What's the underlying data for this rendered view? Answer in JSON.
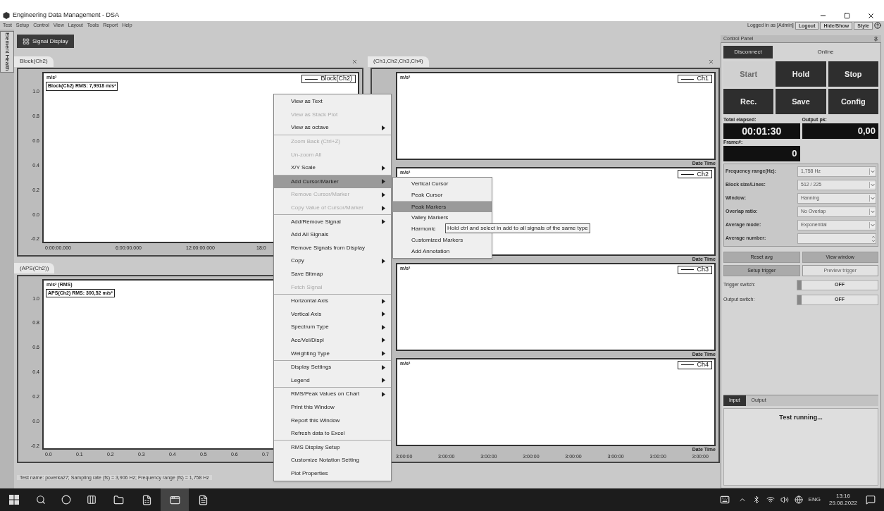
{
  "window": {
    "title": "Engineering Data Management - DSA"
  },
  "menu_bar": [
    "Test",
    "Setup",
    "Control",
    "View",
    "Layout",
    "Tools",
    "Report",
    "Help"
  ],
  "session": {
    "user": "Logged in as [Admin]",
    "buttons": [
      "Logout",
      "Hide/Show",
      "Style"
    ]
  },
  "side_strip": {
    "label": "Element Health"
  },
  "document_tab": {
    "label": "Signal Display",
    "selected": true
  },
  "left_panels": [
    {
      "tab": "Block(Ch2)",
      "y_label": "m/s²",
      "rms_label": "Block(Ch2) RMS: 7,9918 m/s²",
      "legend": "Block(Ch2)",
      "y_ticks": [
        "1.0",
        "0.8",
        "0.6",
        "0.4",
        "0.2",
        "0.0",
        "-0.2"
      ],
      "x_ticks": [
        "0:00:00.000",
        "6:00:00.000",
        "12:00:00.000",
        "18:0"
      ]
    },
    {
      "tab": "(APS(Ch2))",
      "y_label": "m/s² (RMS)",
      "rms_label": "APS(Ch2) RMS: 300,52 m/s²",
      "y_ticks": [
        "1.0",
        "0.8",
        "0.6",
        "0.4",
        "0.2",
        "0.0",
        "-0.2"
      ],
      "x_ticks": [
        "0.0",
        "0.1",
        "0.2",
        "0.3",
        "0.4",
        "0.5",
        "0.6",
        "0.7"
      ]
    }
  ],
  "channels_panel": {
    "tab": "(Ch1,Ch2,Ch3,Ch4)",
    "plots": [
      {
        "y_label": "m/s²",
        "legend": "Ch1",
        "x_caption": "Date Time"
      },
      {
        "y_label": "m/s²",
        "legend": "Ch2",
        "x_caption": "Date Time"
      },
      {
        "y_label": "m/s²",
        "legend": "Ch3",
        "x_caption": "Date Time"
      },
      {
        "y_label": "m/s²",
        "legend": "Ch4",
        "x_caption": "Date Time"
      }
    ],
    "x_ticks": [
      "3:00:00",
      "3:00:00",
      "3:00:00",
      "3:00:00",
      "3:00:00",
      "3:00:00",
      "3:00:00",
      "3:00:00"
    ]
  },
  "control_panel": {
    "title": "Control Panel",
    "connect_button": "Disconnect",
    "connection_status": "Online",
    "run_buttons": [
      {
        "label": "Start",
        "disabled": true
      },
      {
        "label": "Hold",
        "disabled": false
      },
      {
        "label": "Stop",
        "disabled": false
      },
      {
        "label": "Rec.",
        "disabled": false
      },
      {
        "label": "Save",
        "disabled": false
      },
      {
        "label": "Config",
        "disabled": false
      }
    ],
    "readouts": [
      {
        "label": "Total elapsed:",
        "value": "00:01:30"
      },
      {
        "label": "Output pk:",
        "value": "0,00"
      },
      {
        "label": "Frame#:",
        "value": "0"
      }
    ],
    "parameters": [
      {
        "label": "Frequency range(Hz):",
        "value": "1,758 Hz",
        "kind": "dropdown"
      },
      {
        "label": "Block size/Lines:",
        "value": "512 / 225",
        "kind": "dropdown"
      },
      {
        "label": "Window:",
        "value": "Hanning",
        "kind": "dropdown"
      },
      {
        "label": "Overlap ratio:",
        "value": "No Overlap",
        "kind": "dropdown"
      },
      {
        "label": "Average mode:",
        "value": "Exponential",
        "kind": "dropdown"
      },
      {
        "label": "Average number:",
        "kind": "spinner"
      }
    ],
    "action_buttons": [
      {
        "label": "Reset avg",
        "disabled": false
      },
      {
        "label": "View window",
        "disabled": false
      },
      {
        "label": "Setup trigger",
        "disabled": false
      },
      {
        "label": "Preview trigger",
        "disabled": true
      }
    ],
    "switches": [
      {
        "label": "Trigger switch:",
        "state_label": "OFF",
        "on": false
      },
      {
        "label": "Output switch:",
        "state_label": "OFF",
        "on": false
      }
    ],
    "output_tabs": [
      {
        "label": "Input",
        "selected": true
      },
      {
        "label": "Output",
        "selected": false
      }
    ],
    "message": "Test running..."
  },
  "context_menu": {
    "sections": [
      {
        "items": [
          {
            "label": "View as Text",
            "disabled": false,
            "has_submenu": false,
            "selected": false
          },
          {
            "label": "View as Stack Plot",
            "disabled": true,
            "has_submenu": false,
            "selected": false
          },
          {
            "label": "View as octave",
            "disabled": false,
            "has_submenu": true,
            "selected": false
          }
        ]
      },
      {
        "items": [
          {
            "label": "Zoom Back (Ctrl+Z)",
            "disabled": true,
            "has_submenu": false,
            "selected": false
          },
          {
            "label": "Un-zoom All",
            "disabled": true,
            "has_submenu": false,
            "selected": false
          },
          {
            "label": "X/Y Scale",
            "disabled": false,
            "has_submenu": true,
            "selected": false
          }
        ]
      },
      {
        "items": [
          {
            "label": "Add Cursor/Marker",
            "disabled": false,
            "has_submenu": true,
            "selected": true
          },
          {
            "label": "Remove Cursor/Marker",
            "disabled": true,
            "has_submenu": true,
            "selected": false
          },
          {
            "label": "Copy Value of Cursor/Marker",
            "disabled": true,
            "has_submenu": true,
            "selected": false
          }
        ]
      },
      {
        "items": [
          {
            "label": "Add/Remove Signal",
            "disabled": false,
            "has_submenu": true,
            "selected": false
          },
          {
            "label": "Add All Signals",
            "disabled": false,
            "has_submenu": false,
            "selected": false
          },
          {
            "label": "Remove Signals from Display",
            "disabled": false,
            "has_submenu": false,
            "selected": false
          },
          {
            "label": "Copy",
            "disabled": false,
            "has_submenu": true,
            "selected": false
          },
          {
            "label": "Save Bitmap",
            "disabled": false,
            "has_submenu": false,
            "selected": false
          },
          {
            "label": "Fetch Signal",
            "disabled": true,
            "has_submenu": false,
            "selected": false
          }
        ]
      },
      {
        "items": [
          {
            "label": "Horizontal Axis",
            "disabled": false,
            "has_submenu": true,
            "selected": false
          },
          {
            "label": "Vertical Axis",
            "disabled": false,
            "has_submenu": true,
            "selected": false
          },
          {
            "label": "Spectrum Type",
            "disabled": false,
            "has_submenu": true,
            "selected": false
          },
          {
            "label": "Acc/Vel/Displ",
            "disabled": false,
            "has_submenu": true,
            "selected": false
          },
          {
            "label": "Weighting Type",
            "disabled": false,
            "has_submenu": true,
            "selected": false
          }
        ]
      },
      {
        "items": [
          {
            "label": "Display Settings",
            "disabled": false,
            "has_submenu": true,
            "selected": false
          },
          {
            "label": "Legend",
            "disabled": false,
            "has_submenu": true,
            "selected": false
          }
        ]
      },
      {
        "items": [
          {
            "label": "RMS/Peak Values on Chart",
            "disabled": false,
            "has_submenu": true,
            "selected": false
          },
          {
            "label": "Print this Window",
            "disabled": false,
            "has_submenu": false,
            "selected": false
          },
          {
            "label": "Report this Window",
            "disabled": false,
            "has_submenu": false,
            "selected": false
          },
          {
            "label": "Refresh data to Excel",
            "disabled": false,
            "has_submenu": false,
            "selected": false
          }
        ]
      },
      {
        "items": [
          {
            "label": "RMS Display Setup",
            "disabled": false,
            "has_submenu": false,
            "selected": false
          },
          {
            "label": "Customize Notation Setting",
            "disabled": false,
            "has_submenu": false,
            "selected": false
          },
          {
            "label": "Plot Properties",
            "disabled": false,
            "has_submenu": false,
            "selected": false
          }
        ]
      }
    ]
  },
  "submenu": {
    "items": [
      {
        "label": "Vertical Cursor",
        "selected": false
      },
      {
        "label": "Peak Cursor",
        "selected": false
      },
      {
        "label": "Peak Markers",
        "selected": true
      },
      {
        "label": "Valley Markers",
        "selected": false
      },
      {
        "label": "Harmonic",
        "selected": false
      },
      {
        "label": "Customized Markers",
        "selected": false
      },
      {
        "label": "Add Annotation",
        "selected": false
      }
    ]
  },
  "tooltip": "Hold ctrl and select in add to all signals of the same type",
  "status_bar": "Test name: poverka27; Sampling rate (fs) = 3,906 Hz; Frequency range (fs) = 1,758 Hz",
  "taskbar": {
    "apps": [
      {
        "kind": "explorer",
        "selected": false
      },
      {
        "kind": "excel",
        "selected": false
      },
      {
        "kind": "app",
        "selected": true
      },
      {
        "kind": "word",
        "selected": false
      }
    ],
    "tray": {
      "language": "ENG",
      "time": "13:16",
      "date": "29.08.2022"
    }
  }
}
